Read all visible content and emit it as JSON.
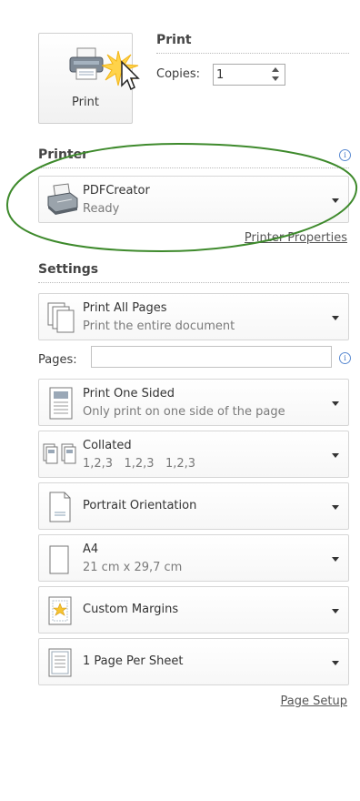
{
  "print_section": {
    "title": "Print",
    "print_button_label": "Print",
    "copies_label": "Copies:",
    "copies_value": "1"
  },
  "printer_section": {
    "title": "Printer",
    "info_icon": "info-icon",
    "printer": {
      "name": "PDFCreator",
      "status": "Ready",
      "icon": "printer-icon"
    },
    "properties_link": "Printer Properties"
  },
  "settings_section": {
    "title": "Settings",
    "pages_label": "Pages:",
    "pages_value": "",
    "items": [
      {
        "title": "Print All Pages",
        "subtitle": "Print the entire document",
        "icon": "pages-icon"
      },
      {
        "title": "Print One Sided",
        "subtitle": "Only print on one side of the page",
        "icon": "one-sided-icon"
      },
      {
        "title": "Collated",
        "subtitle": "1,2,3   1,2,3   1,2,3",
        "icon": "collated-icon"
      },
      {
        "title": "Portrait Orientation",
        "subtitle": "",
        "icon": "portrait-icon"
      },
      {
        "title": "A4",
        "subtitle": "21 cm x 29,7 cm",
        "icon": "paper-size-icon"
      },
      {
        "title": "Custom Margins",
        "subtitle": "",
        "icon": "margins-icon"
      },
      {
        "title": "1 Page Per Sheet",
        "subtitle": "",
        "icon": "pages-per-sheet-icon"
      }
    ],
    "page_setup_link": "Page Setup"
  },
  "colors": {
    "highlight_ellipse": "#3e8a2c",
    "link": "#555555",
    "info": "#3f74c6"
  }
}
